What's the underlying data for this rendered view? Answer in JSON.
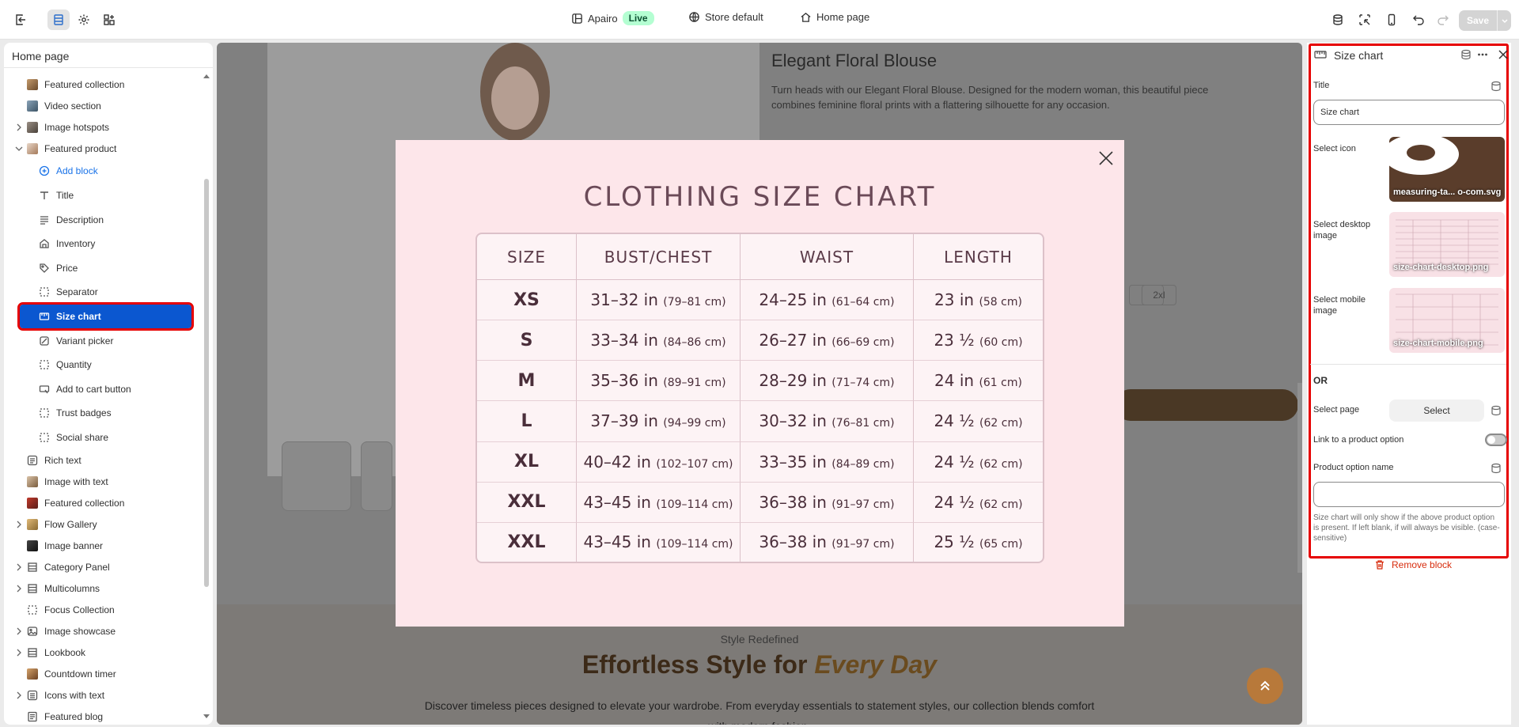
{
  "topbar": {
    "store_name": "Apairo",
    "live_badge": "Live",
    "theme": "Store default",
    "page": "Home page",
    "save_label": "Save"
  },
  "left_panel": {
    "title": "Home page",
    "items": [
      {
        "label": "Featured collection",
        "icon": "image-thumb"
      },
      {
        "label": "Video section",
        "icon": "video-thumb"
      },
      {
        "label": "Image hotspots",
        "icon": "image-thumb"
      },
      {
        "label": "Featured product",
        "icon": "product-thumb"
      },
      {
        "label": "Add block",
        "icon": "plus-circle-icon"
      },
      {
        "label": "Title",
        "icon": "text-icon"
      },
      {
        "label": "Description",
        "icon": "paragraph-icon"
      },
      {
        "label": "Inventory",
        "icon": "inventory-icon"
      },
      {
        "label": "Price",
        "icon": "tag-icon"
      },
      {
        "label": "Separator",
        "icon": "block-icon"
      },
      {
        "label": "Size chart",
        "icon": "ruler-icon"
      },
      {
        "label": "Variant picker",
        "icon": "variant-icon"
      },
      {
        "label": "Quantity",
        "icon": "block-icon"
      },
      {
        "label": "Add to cart button",
        "icon": "button-icon"
      },
      {
        "label": "Trust badges",
        "icon": "block-icon"
      },
      {
        "label": "Social share",
        "icon": "block-icon"
      },
      {
        "label": "Rich text",
        "icon": "text-section-icon"
      },
      {
        "label": "Image with text",
        "icon": "image-thumb"
      },
      {
        "label": "Featured collection",
        "icon": "image-thumb"
      },
      {
        "label": "Flow Gallery",
        "icon": "image-thumb"
      },
      {
        "label": "Image banner",
        "icon": "image-thumb"
      },
      {
        "label": "Category Panel",
        "icon": "layout-icon"
      },
      {
        "label": "Multicolumns",
        "icon": "layout-icon"
      },
      {
        "label": "Focus Collection",
        "icon": "block-icon"
      },
      {
        "label": "Image showcase",
        "icon": "image-icon"
      },
      {
        "label": "Lookbook",
        "icon": "layout-icon"
      },
      {
        "label": "Countdown timer",
        "icon": "image-thumb"
      },
      {
        "label": "Icons with text",
        "icon": "list-icon"
      },
      {
        "label": "Featured blog",
        "icon": "blog-icon"
      }
    ]
  },
  "preview": {
    "product_title": "Elegant Floral Blouse",
    "product_desc": "Turn heads with our Elegant Floral Blouse. Designed for the modern woman, this beautiful piece combines feminine floral prints with a flattering silhouette for any occasion.",
    "size_option": "2xl",
    "section_sub": "Style Redefined",
    "section_head": "Effortless Style for",
    "section_head_em": "Every Day",
    "section_body": "Discover timeless pieces designed to elevate your wardrobe. From everyday essentials to statement styles, our collection blends comfort with modern fashion."
  },
  "size_chart": {
    "title": "CLOTHING SIZE CHART",
    "headers": [
      "SIZE",
      "BUST/CHEST",
      "WAIST",
      "LENGTH"
    ],
    "rows": [
      [
        "XS",
        "31–32 in",
        "(79–81 cm)",
        "24–25 in",
        "(61–64 cm)",
        "23 in",
        "(58 cm)"
      ],
      [
        "S",
        "33–34 in",
        "(84–86 cm)",
        "26–27 in",
        "(66–69 cm)",
        "23 ½",
        "(60 cm)"
      ],
      [
        "M",
        "35–36 in",
        "(89–91 cm)",
        "28–29 in",
        "(71–74 cm)",
        "24 in",
        "(61 cm)"
      ],
      [
        "L",
        "37–39 in",
        "(94–99 cm)",
        "30–32 in",
        "(76–81 cm)",
        "24 ½",
        "(62 cm)"
      ],
      [
        "XL",
        "40–42 in",
        "(102–107 cm)",
        "33–35 in",
        "(84–89 cm)",
        "24 ½",
        "(62 cm)"
      ],
      [
        "XXL",
        "43–45 in",
        "(109–114 cm)",
        "36–38 in",
        "(91–97 cm)",
        "24 ½",
        "(62 cm)"
      ],
      [
        "XXL",
        "43–45 in",
        "(109–114 cm)",
        "36–38 in",
        "(91–97 cm)",
        "25 ½",
        "(65 cm)"
      ]
    ]
  },
  "right_panel": {
    "title": "Size chart",
    "title_label": "Title",
    "title_value": "Size chart",
    "select_icon_label": "Select icon",
    "icon_file": "measuring-ta... o-com.svg",
    "desktop_label": "Select desktop image",
    "desktop_file": "size-chart-desktop.png",
    "mobile_label": "Select mobile image",
    "mobile_file": "size-chart-mobile.png",
    "or_label": "OR",
    "select_page_label": "Select page",
    "select_button": "Select",
    "link_label": "Link to a product option",
    "option_name_label": "Product option name",
    "option_name_value": "",
    "help_text": "Size chart will only show if the above product option is present. If left blank, if will always be visible. (case-sensitive)",
    "remove_label": "Remove block"
  }
}
